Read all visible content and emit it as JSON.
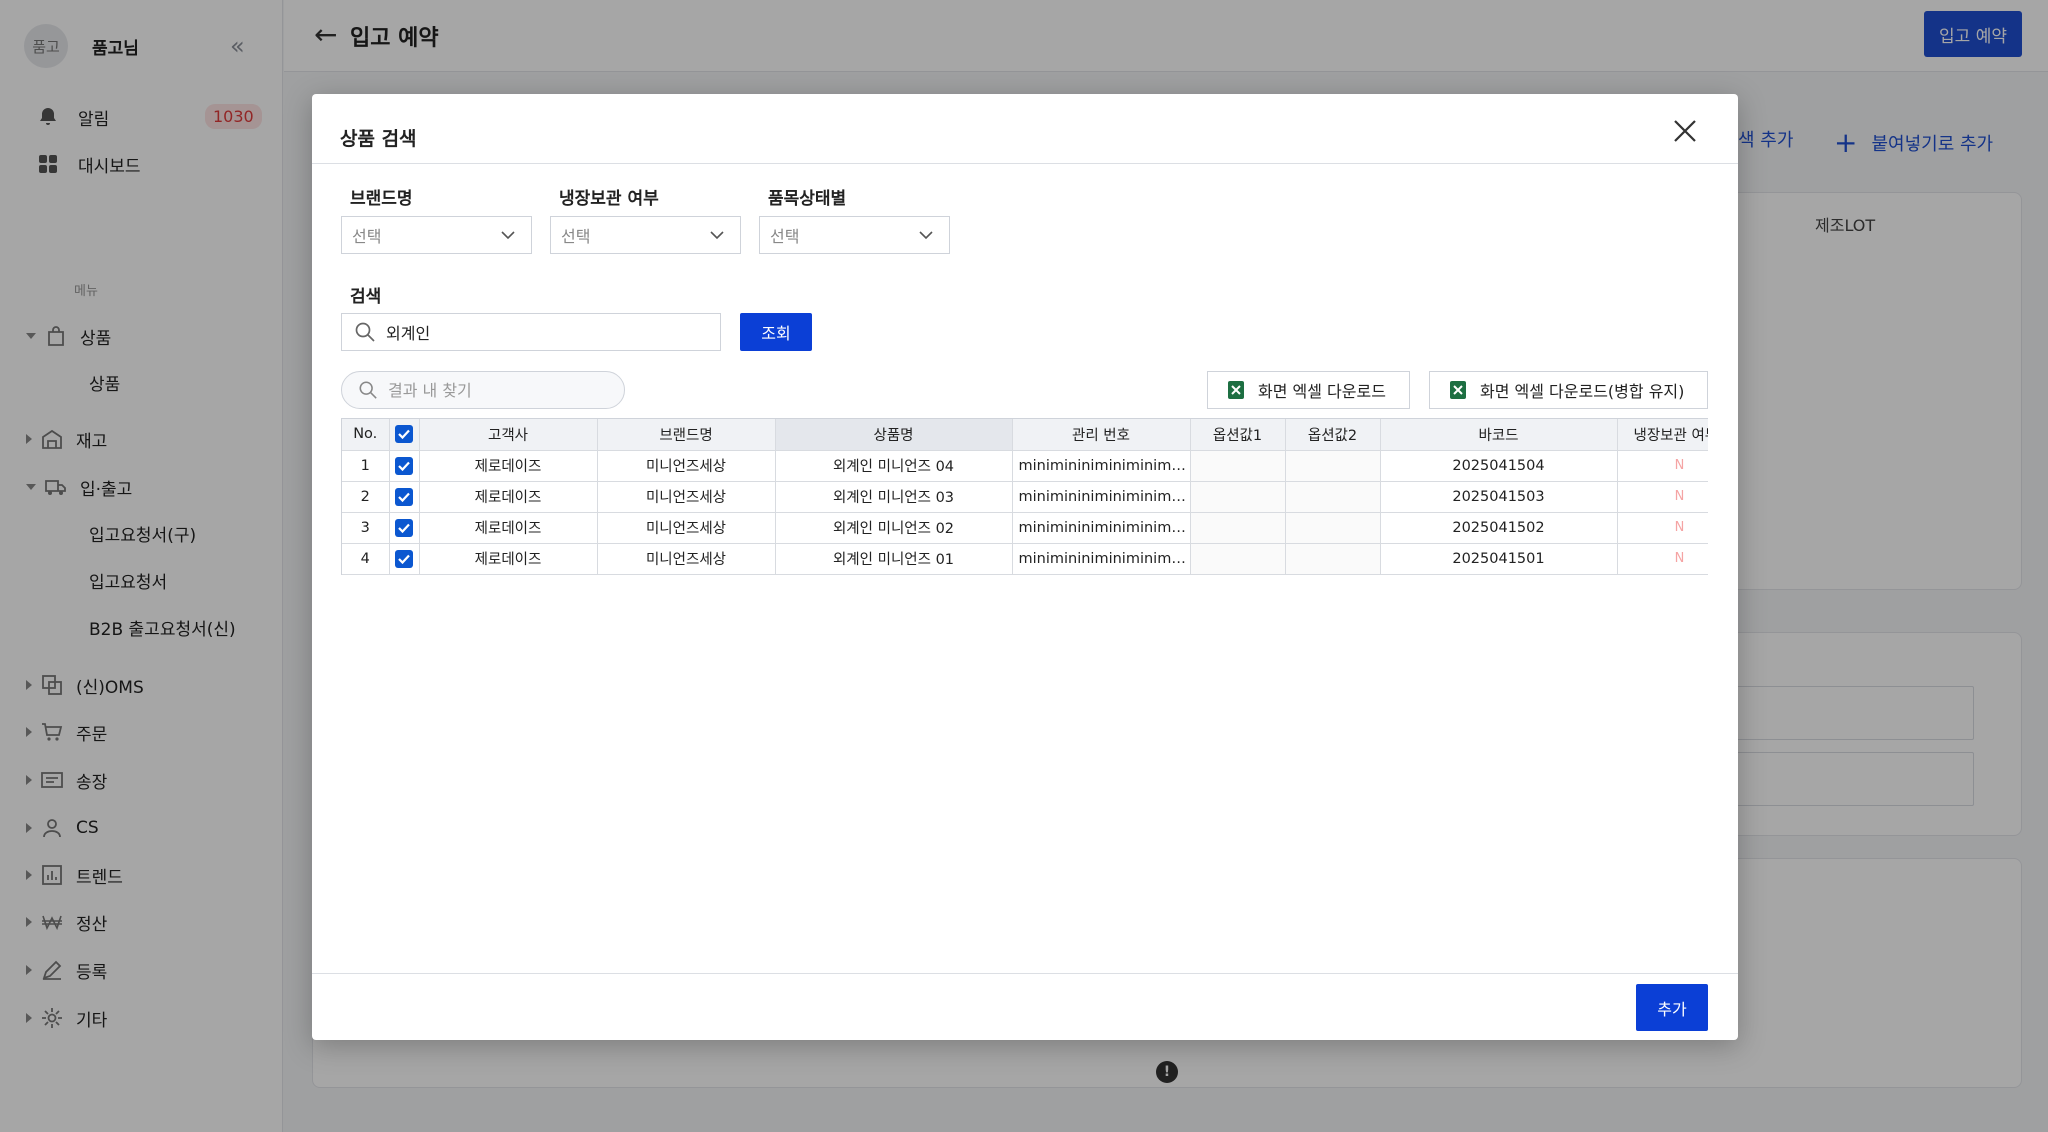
{
  "sidebar": {
    "avatar_text": "품고",
    "user_name": "품고님",
    "alarm_label": "알림",
    "alarm_count": "1030",
    "dashboard_label": "대시보드",
    "menu_label": "메뉴",
    "groups": [
      {
        "label": "상품"
      },
      {
        "label": "재고"
      },
      {
        "label": "입·출고"
      },
      {
        "label": "(신)OMS"
      },
      {
        "label": "주문"
      },
      {
        "label": "송장"
      },
      {
        "label": "CS"
      },
      {
        "label": "트렌드"
      },
      {
        "label": "정산"
      },
      {
        "label": "등록"
      },
      {
        "label": "기타"
      }
    ],
    "sub_items": [
      {
        "label": "상품"
      },
      {
        "label": "입고요청서(구)"
      },
      {
        "label": "입고요청서"
      },
      {
        "label": "B2B 출고요청서(신)"
      }
    ]
  },
  "header": {
    "title": "입고 예약",
    "reserve_button": "입고 예약"
  },
  "background": {
    "search_add": "색 추가",
    "paste_add": "붙여넣기로 추가",
    "lot_column": "제조LOT"
  },
  "modal": {
    "title": "상품 검색",
    "filters": [
      {
        "label": "브랜드명",
        "value": "선택"
      },
      {
        "label": "냉장보관 여부",
        "value": "선택"
      },
      {
        "label": "품목상태별",
        "value": "선택"
      }
    ],
    "search_label": "검색",
    "search_value": "외계인",
    "query_button": "조회",
    "find_placeholder": "결과 내 찾기",
    "excel_button": "화면 엑셀 다운로드",
    "excel_merge_button": "화면 엑셀 다운로드(병합 유지)",
    "columns": [
      "No.",
      "고객사",
      "브랜드명",
      "상품명",
      "관리 번호",
      "옵션값1",
      "옵션값2",
      "바코드",
      "냉장보관 여부"
    ],
    "rows": [
      {
        "no": "1",
        "customer": "제로데이즈",
        "brand": "미니언즈세상",
        "product": "외계인 미니언즈 04",
        "mgmt": "minimininiminiminiminimini",
        "opt1": "",
        "opt2": "",
        "barcode": "2025041504",
        "cold": "N"
      },
      {
        "no": "2",
        "customer": "제로데이즈",
        "brand": "미니언즈세상",
        "product": "외계인 미니언즈 03",
        "mgmt": "minimininiminiminiminimini",
        "opt1": "",
        "opt2": "",
        "barcode": "2025041503",
        "cold": "N"
      },
      {
        "no": "3",
        "customer": "제로데이즈",
        "brand": "미니언즈세상",
        "product": "외계인 미니언즈 02",
        "mgmt": "minimininiminiminiminimini",
        "opt1": "",
        "opt2": "",
        "barcode": "2025041502",
        "cold": "N"
      },
      {
        "no": "4",
        "customer": "제로데이즈",
        "brand": "미니언즈세상",
        "product": "외계인 미니언즈 01",
        "mgmt": "minimininiminiminiminimini",
        "opt1": "",
        "opt2": "",
        "barcode": "2025041501",
        "cold": "N"
      }
    ],
    "add_button": "추가"
  },
  "colors": {
    "primary": "#0b3fd6",
    "checkbox": "#0b57d0",
    "badge_text": "#e03b3b",
    "cold_n": "#f5a4a4",
    "excel_green": "#1d6f42"
  },
  "icons": [
    "bell-icon",
    "dashboard-icon",
    "bag-icon",
    "warehouse-icon",
    "truck-icon",
    "oms-icon",
    "cart-icon",
    "invoice-icon",
    "person-icon",
    "chart-icon",
    "won-icon",
    "pencil-icon",
    "gear-icon",
    "close-icon",
    "search-icon",
    "chevron-down-icon",
    "excel-icon",
    "check-icon",
    "back-arrow-icon",
    "info-icon"
  ]
}
